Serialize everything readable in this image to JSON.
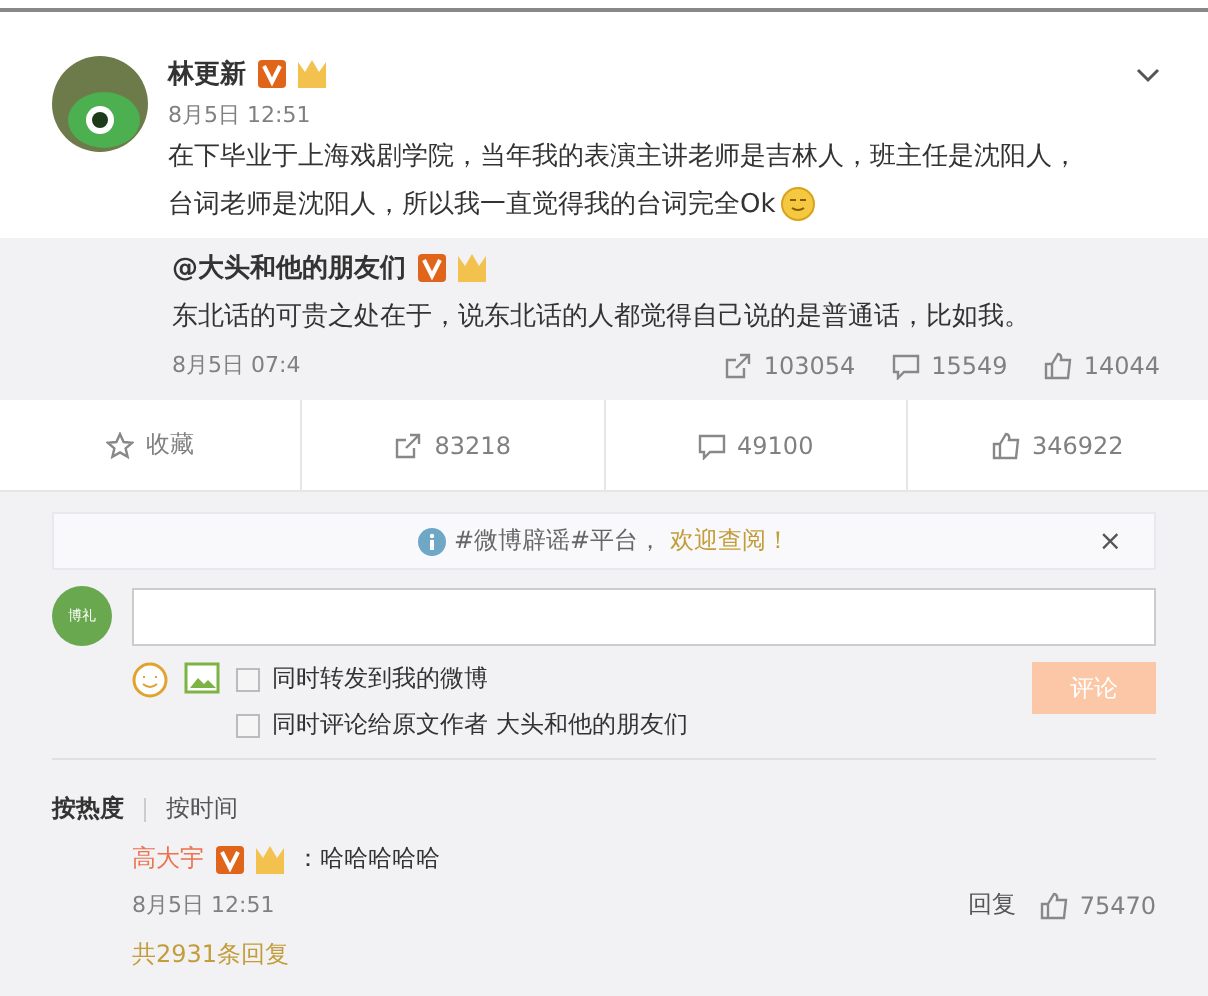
{
  "post": {
    "author": "林更新",
    "time": "8月5日 12:51",
    "text_lines": [
      "在下毕业于上海戏剧学院，当年我的表演主讲老师是吉林人，班主任是沈阳人，",
      "台词老师是沈阳人，所以我一直觉得我的台词完全Ok"
    ]
  },
  "repost": {
    "author": "@大头和他的朋友们",
    "text": "东北话的可贵之处在于，说东北话的人都觉得自己说的是普通话，比如我。",
    "time": "8月5日 07:4",
    "reposts": "103054",
    "comments": "15549",
    "likes": "14044"
  },
  "actions": [
    {
      "kind": "favorite",
      "label": "收藏"
    },
    {
      "kind": "repost",
      "label": "83218"
    },
    {
      "kind": "comment",
      "label": "49100"
    },
    {
      "kind": "like",
      "label": "346922"
    }
  ],
  "notice": {
    "text": "#微博辟谣#平台，",
    "link": "欢迎查阅！",
    "close": "×"
  },
  "composer": {
    "avatar_text": "博礼",
    "options": [
      {
        "label": "同时转发到我的微博",
        "checked": false
      },
      {
        "label": "同时评论给原文作者 大头和他的朋友们",
        "checked": false
      }
    ],
    "submit": "评论"
  },
  "sort_tabs": [
    {
      "label": "按热度",
      "selected": true
    },
    {
      "label": "按时间",
      "selected": false
    }
  ],
  "comment": {
    "author": "高大宇",
    "text": "：哈哈哈哈哈",
    "time": "8月5日 12:51",
    "reply": "回复",
    "likes": "75470",
    "replies_note": "共2931条回复"
  }
}
